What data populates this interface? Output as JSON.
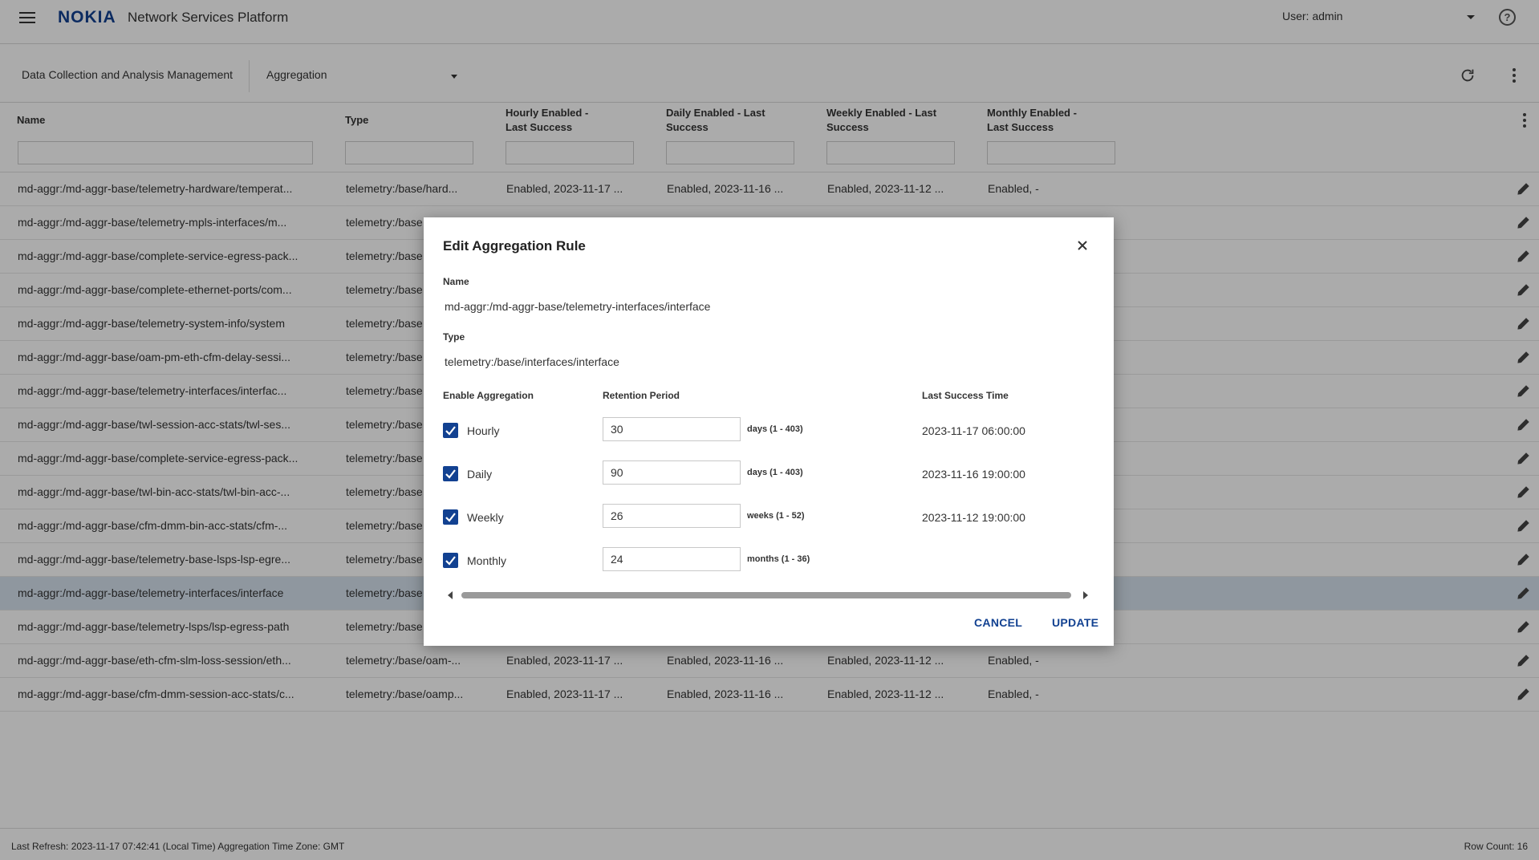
{
  "app": {
    "logo": "NOKIA",
    "title": "Network Services Platform",
    "user_label": "User: admin"
  },
  "subbar": {
    "title": "Data Collection and Analysis Management",
    "view": "Aggregation"
  },
  "table": {
    "columns": [
      "Name",
      "Type",
      "Hourly Enabled - Last Success",
      "Daily Enabled - Last Success",
      "Weekly Enabled - Last Success",
      "Monthly Enabled - Last Success"
    ],
    "rows": [
      {
        "name": "md-aggr:/md-aggr-base/telemetry-hardware/temperat...",
        "type": "telemetry:/base/hard...",
        "hourly": "Enabled, 2023-11-17 ...",
        "daily": "Enabled, 2023-11-16 ...",
        "weekly": "Enabled, 2023-11-12 ...",
        "monthly": "Enabled, -"
      },
      {
        "name": "md-aggr:/md-aggr-base/telemetry-mpls-interfaces/m...",
        "type": "telemetry:/base",
        "hourly": "",
        "daily": "",
        "weekly": "",
        "monthly": ""
      },
      {
        "name": "md-aggr:/md-aggr-base/complete-service-egress-pack...",
        "type": "telemetry:/base",
        "hourly": "",
        "daily": "",
        "weekly": "",
        "monthly": ""
      },
      {
        "name": "md-aggr:/md-aggr-base/complete-ethernet-ports/com...",
        "type": "telemetry:/base",
        "hourly": "",
        "daily": "",
        "weekly": "",
        "monthly": ""
      },
      {
        "name": "md-aggr:/md-aggr-base/telemetry-system-info/system",
        "type": "telemetry:/base",
        "hourly": "",
        "daily": "",
        "weekly": "",
        "monthly": ""
      },
      {
        "name": "md-aggr:/md-aggr-base/oam-pm-eth-cfm-delay-sessi...",
        "type": "telemetry:/base",
        "hourly": "",
        "daily": "",
        "weekly": "",
        "monthly": ""
      },
      {
        "name": "md-aggr:/md-aggr-base/telemetry-interfaces/interfac...",
        "type": "telemetry:/base",
        "hourly": "",
        "daily": "",
        "weekly": "",
        "monthly": ""
      },
      {
        "name": "md-aggr:/md-aggr-base/twl-session-acc-stats/twl-ses...",
        "type": "telemetry:/base",
        "hourly": "",
        "daily": "",
        "weekly": "",
        "monthly": ""
      },
      {
        "name": "md-aggr:/md-aggr-base/complete-service-egress-pack...",
        "type": "telemetry:/base",
        "hourly": "",
        "daily": "",
        "weekly": "",
        "monthly": ""
      },
      {
        "name": "md-aggr:/md-aggr-base/twl-bin-acc-stats/twl-bin-acc-...",
        "type": "telemetry:/base",
        "hourly": "",
        "daily": "",
        "weekly": "",
        "monthly": ""
      },
      {
        "name": "md-aggr:/md-aggr-base/cfm-dmm-bin-acc-stats/cfm-...",
        "type": "telemetry:/base",
        "hourly": "",
        "daily": "",
        "weekly": "",
        "monthly": ""
      },
      {
        "name": "md-aggr:/md-aggr-base/telemetry-base-lsps-lsp-egre...",
        "type": "telemetry:/base",
        "hourly": "",
        "daily": "",
        "weekly": "",
        "monthly": ""
      },
      {
        "name": "md-aggr:/md-aggr-base/telemetry-interfaces/interface",
        "type": "telemetry:/base",
        "hourly": "",
        "daily": "",
        "weekly": "",
        "monthly": "",
        "selected": true
      },
      {
        "name": "md-aggr:/md-aggr-base/telemetry-lsps/lsp-egress-path",
        "type": "telemetry:/base",
        "hourly": "",
        "daily": "",
        "weekly": "",
        "monthly": ""
      },
      {
        "name": "md-aggr:/md-aggr-base/eth-cfm-slm-loss-session/eth...",
        "type": "telemetry:/base/oam-...",
        "hourly": "Enabled, 2023-11-17 ...",
        "daily": "Enabled, 2023-11-16 ...",
        "weekly": "Enabled, 2023-11-12 ...",
        "monthly": "Enabled, -"
      },
      {
        "name": "md-aggr:/md-aggr-base/cfm-dmm-session-acc-stats/c...",
        "type": "telemetry:/base/oamp...",
        "hourly": "Enabled, 2023-11-17 ...",
        "daily": "Enabled, 2023-11-16 ...",
        "weekly": "Enabled, 2023-11-12 ...",
        "monthly": "Enabled, -"
      }
    ]
  },
  "status": {
    "left": "Last Refresh: 2023-11-17 07:42:41 (Local Time)   Aggregation Time Zone: GMT",
    "right": "Row Count: 16"
  },
  "dialog": {
    "title": "Edit Aggregation Rule",
    "name_label": "Name",
    "name_value": "md-aggr:/md-aggr-base/telemetry-interfaces/interface",
    "type_label": "Type",
    "type_value": "telemetry:/base/interfaces/interface",
    "col_enable": "Enable Aggregation",
    "col_retention": "Retention Period",
    "col_last_success": "Last Success Time",
    "rows": [
      {
        "label": "Hourly",
        "checked": true,
        "retention": "30",
        "range": "days (1 - 403)",
        "last_success": "2023-11-17 06:00:00"
      },
      {
        "label": "Daily",
        "checked": true,
        "retention": "90",
        "range": "days (1 - 403)",
        "last_success": "2023-11-16 19:00:00"
      },
      {
        "label": "Weekly",
        "checked": true,
        "retention": "26",
        "range": "weeks (1 - 52)",
        "last_success": "2023-11-12 19:00:00"
      },
      {
        "label": "Monthly",
        "checked": true,
        "retention": "24",
        "range": "months (1 - 36)",
        "last_success": ""
      }
    ],
    "cancel_label": "CANCEL",
    "update_label": "UPDATE"
  },
  "colors": {
    "brand": "#124191",
    "selected_row": "#d5e1ee"
  }
}
